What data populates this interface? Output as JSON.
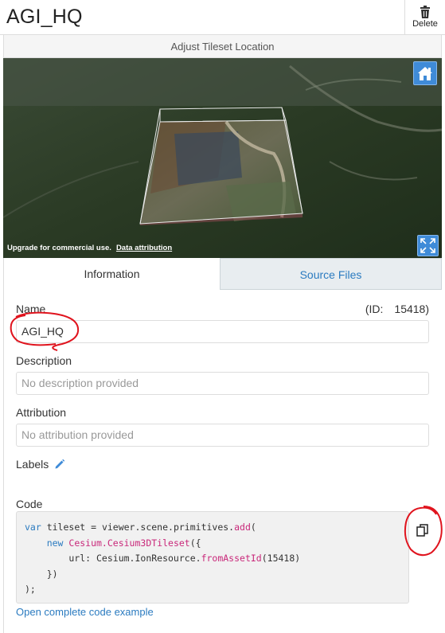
{
  "header": {
    "title": "AGI_HQ",
    "delete_label": "Delete"
  },
  "toolbar": {
    "adjust_label": "Adjust Tileset Location"
  },
  "viewer": {
    "credit_text": "Upgrade for commercial use.",
    "attribution_link": "Data attribution",
    "home_icon": "home-icon",
    "fullscreen_icon": "fullscreen-icon"
  },
  "tabs": [
    {
      "label": "Information",
      "active": true
    },
    {
      "label": "Source Files",
      "active": false
    }
  ],
  "info": {
    "name_label": "Name",
    "id_label": "(ID:",
    "id_value": "15418)",
    "name_value": "AGI_HQ",
    "description_label": "Description",
    "description_placeholder": "No description provided",
    "attribution_label": "Attribution",
    "attribution_placeholder": "No attribution provided",
    "labels_label": "Labels",
    "code_label": "Code",
    "code_lines": [
      {
        "t1": "var",
        "t2": " tileset = viewer.scene.primitives.",
        "t3": "add",
        "t4": "("
      },
      {
        "t1": "    new ",
        "t2": "Cesium.Cesium3DTileset",
        "t3": "({"
      },
      {
        "t1": "        url: Cesium.IonResource.",
        "t2": "fromAssetId",
        "t3": "(15418)"
      },
      {
        "t1": "    })"
      },
      {
        "t1": ");"
      }
    ],
    "example_link": "Open complete code example"
  },
  "colors": {
    "accent": "#2b7bc0",
    "button_blue": "#3f8bd8",
    "annotation_red": "#e0141e"
  }
}
